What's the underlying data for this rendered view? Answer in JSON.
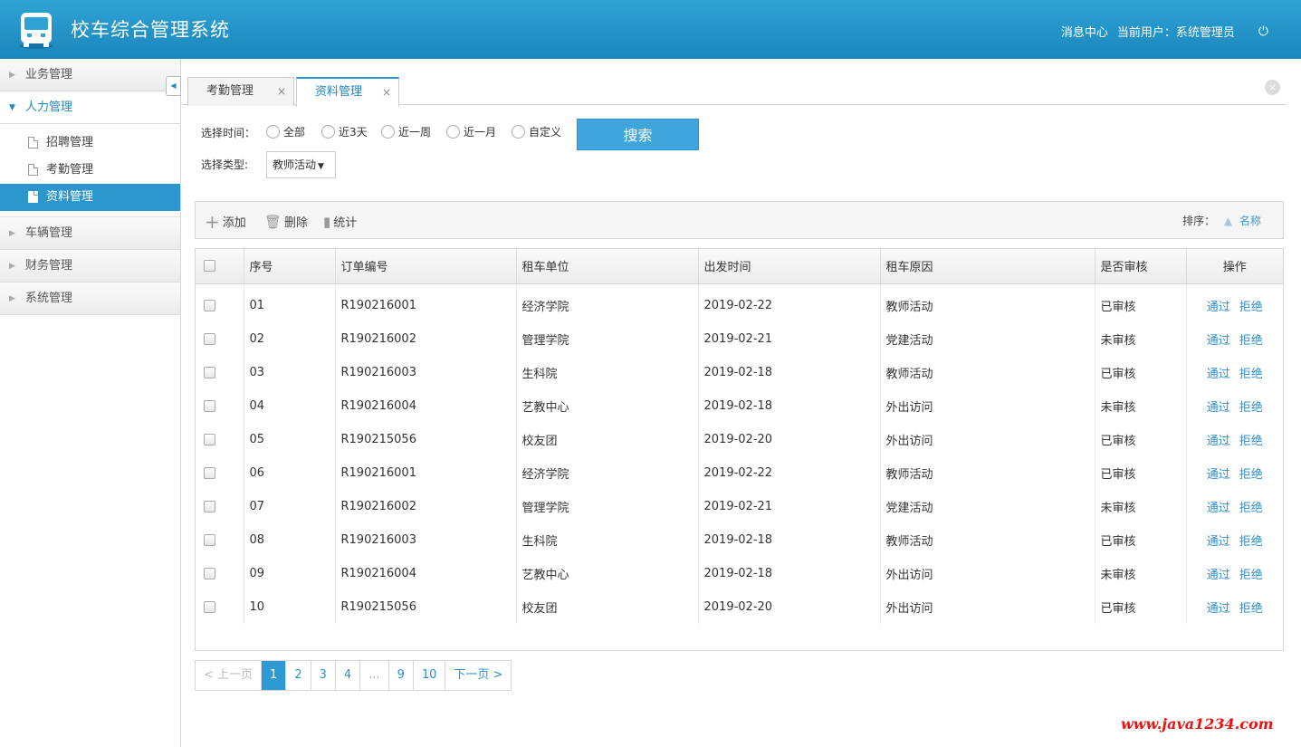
{
  "header": {
    "title": "校车综合管理系统",
    "message_center": "消息中心",
    "current_user_label": "当前用户：系统管理员",
    "logout_icon": "power-icon"
  },
  "sidebar": {
    "groups": [
      {
        "label": "业务管理",
        "expanded": false
      },
      {
        "label": "人力管理",
        "expanded": true,
        "items": [
          "招聘管理",
          "考勤管理",
          "资料管理"
        ],
        "active": "资料管理"
      },
      {
        "label": "车辆管理",
        "expanded": false
      },
      {
        "label": "财务管理",
        "expanded": false
      },
      {
        "label": "系统管理",
        "expanded": false
      }
    ]
  },
  "tabs": [
    {
      "label": "考勤管理",
      "active": false
    },
    {
      "label": "资料管理",
      "active": true
    }
  ],
  "filters": {
    "time_label": "选择时间：",
    "time_options": [
      "全部",
      "近3天",
      "近一周",
      "近一月",
      "自定义"
    ],
    "type_label": "选择类型:",
    "type_value": "教师活动",
    "search_button": "搜索"
  },
  "toolbar": {
    "add": "添加",
    "delete": "删除",
    "stats": "统计",
    "sort_label": "排序：",
    "sort_field": "名称"
  },
  "table": {
    "columns": [
      "序号",
      "订单编号",
      "租车单位",
      "出发时间",
      "租车原因",
      "是否审核",
      "操作"
    ],
    "rows": [
      [
        "01",
        "R190216001",
        "经济学院",
        "2019-02-22",
        "教师活动",
        "已审核"
      ],
      [
        "02",
        "R190216002",
        "管理学院",
        "2019-02-21",
        "党建活动",
        "未审核"
      ],
      [
        "03",
        "R190216003",
        "生科院",
        "2019-02-18",
        "教师活动",
        "已审核"
      ],
      [
        "04",
        "R190216004",
        "艺教中心",
        "2019-02-18",
        "外出访问",
        "未审核"
      ],
      [
        "05",
        "R190215056",
        "校友团",
        "2019-02-20",
        "外出访问",
        "已审核"
      ],
      [
        "06",
        "R190216001",
        "经济学院",
        "2019-02-22",
        "教师活动",
        "已审核"
      ],
      [
        "07",
        "R190216002",
        "管理学院",
        "2019-02-21",
        "党建活动",
        "未审核"
      ],
      [
        "08",
        "R190216003",
        "生科院",
        "2019-02-18",
        "教师活动",
        "已审核"
      ],
      [
        "09",
        "R190216004",
        "艺教中心",
        "2019-02-18",
        "外出访问",
        "未审核"
      ],
      [
        "10",
        "R190215056",
        "校友团",
        "2019-02-20",
        "外出访问",
        "已审核"
      ]
    ],
    "actions": [
      "通过",
      "拒绝"
    ]
  },
  "pagination": {
    "prev": "< 上一页",
    "pages": [
      "1",
      "2",
      "3",
      "4",
      "...",
      "9",
      "10"
    ],
    "current": "1",
    "next": "下一页 >"
  },
  "watermark": "www.java1234.com",
  "colors": {
    "header": "#1f8ac6",
    "accent": "#2c97cf",
    "link": "#2e8fd0",
    "watermark": "#e11"
  }
}
